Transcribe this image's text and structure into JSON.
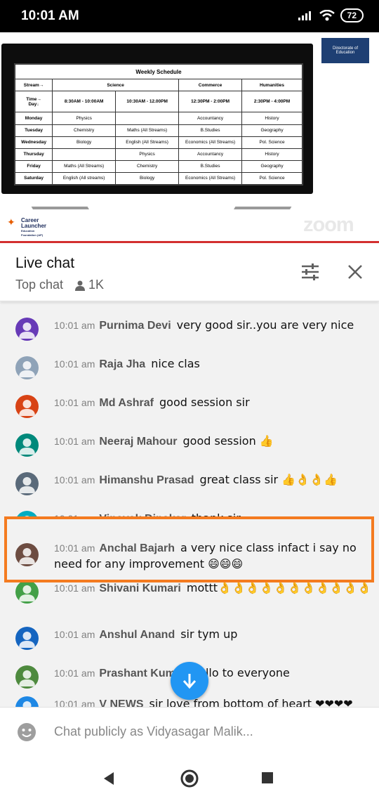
{
  "status": {
    "time": "10:01 AM",
    "battery": "72"
  },
  "video": {
    "schedule": {
      "title": "Weekly Schedule",
      "stream_label": "Stream→",
      "time_label": "Time→",
      "day_label": "Day↓",
      "streams": [
        "Science",
        "Commerce",
        "Humanities"
      ],
      "slots": [
        "8:30AM - 10:00AM",
        "10:30AM - 12.00PM",
        "12:30PM - 2:00PM",
        "2:30PM - 4:00PM"
      ],
      "rows": [
        [
          "Monday",
          "Physics",
          "",
          "Accountancy",
          "History"
        ],
        [
          "Tuesday",
          "Chemistry",
          "Maths (All Streams)",
          "B.Studies",
          "Geography"
        ],
        [
          "Wednesday",
          "Biology",
          "English (All Streams)",
          "Economics (All Streams)",
          "Pol. Science"
        ],
        [
          "Thursday",
          "",
          "Physics",
          "Accountancy",
          "History"
        ],
        [
          "Friday",
          "Maths (All Streams)",
          "Chemistry",
          "B.Studies",
          "Geography"
        ],
        [
          "Saturday",
          "English (All streams)",
          "Biology",
          "Economics (All Streams)",
          "Pol. Science"
        ]
      ]
    },
    "logo_directorate": "Directorate of Education",
    "logo_career": "Career Launcher",
    "logo_career_sub": "Education Foundation (AP)",
    "watermark": "zoom"
  },
  "chat_header": {
    "title": "Live chat",
    "mode": "Top chat",
    "viewers": "1K"
  },
  "messages": [
    {
      "time": "10:01 am",
      "author": "Purnima Devi",
      "text": "very good sir..you are very nice",
      "avatar_color": "#673ab7"
    },
    {
      "time": "10:01 am",
      "author": "Raja Jha",
      "text": "nice clas",
      "avatar_color": "#8fa3b8"
    },
    {
      "time": "10:01 am",
      "author": "Md Ashraf",
      "text": "good session sir",
      "avatar_color": "#d84315"
    },
    {
      "time": "10:01 am",
      "author": "Neeraj Mahour",
      "text": "good session 👍",
      "avatar_color": "#00897b"
    },
    {
      "time": "10:01 am",
      "author": "Himanshu Prasad",
      "text": "great class sir 👍👌👌👍",
      "avatar_color": "#5a6a7a"
    },
    {
      "time": "10:01 am",
      "author": "Vinayak Dinakar",
      "text": "thank sir",
      "avatar_color": "#00acc1"
    },
    {
      "time": "10:01 am",
      "author": "Anchal Bajarh",
      "text": "a very nice class infact i say no need for any improvement 😄😄😄",
      "avatar_color": "#6d4c41"
    },
    {
      "time": "10:01 am",
      "author": "Shivani Kumari",
      "text": "mottt👌👌👌👌👌👌👌👌👌👌👌",
      "avatar_color": "#43a047"
    },
    {
      "time": "10:01 am",
      "author": "Anshul Anand",
      "text": "sir tym up",
      "avatar_color": "#1565c0"
    },
    {
      "time": "10:01 am",
      "author": "Prashant Kumar",
      "text": "hello to everyone",
      "avatar_color": "#4e8a3e"
    },
    {
      "time": "10:01 am",
      "author": "V NEWS",
      "text": "sir love from bottom of heart ❤❤❤❤",
      "avatar_color": "#1e88e5"
    }
  ],
  "input": {
    "placeholder": "Chat publicly as Vidyasagar Malik..."
  },
  "colors": {
    "highlight": "#f47b20",
    "accent": "#2196f3",
    "video_divider": "#d32f2f"
  }
}
